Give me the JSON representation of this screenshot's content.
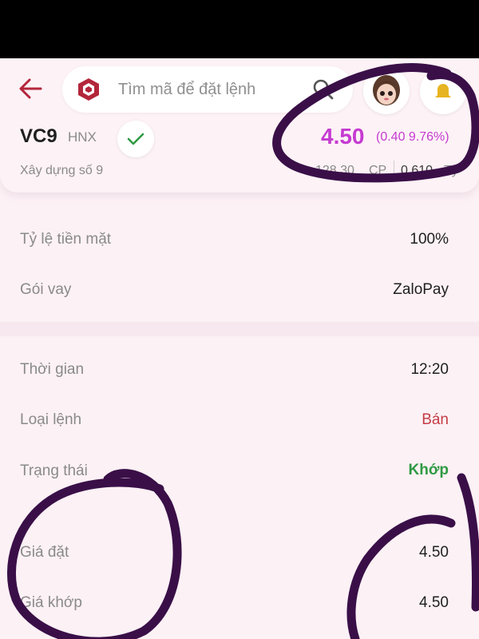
{
  "header": {
    "search": {
      "placeholder": "Tìm mã để đặt lệnh"
    },
    "stock": {
      "ticker": "VC9",
      "exchange": "HNX",
      "company": "Xây dựng số 9",
      "price": "4.50",
      "change": "(0.40 9.76%)",
      "volume": "128.30",
      "volume_unit": "CP",
      "value": "0.610",
      "value_unit": "Tỷ"
    }
  },
  "details": {
    "loan_section": [
      {
        "label": "Tỷ lệ tiền mặt",
        "value": "100%"
      },
      {
        "label": "Gói vay",
        "value": "ZaloPay"
      }
    ],
    "order_section": [
      {
        "label": "Thời gian",
        "value": "12:20"
      },
      {
        "label": "Loại lệnh",
        "value": "Bán"
      },
      {
        "label": "Trạng thái",
        "value": "Khớp"
      },
      {
        "label": "Giá đặt",
        "value": "4.50"
      },
      {
        "label": "Giá khớp",
        "value": "4.50"
      }
    ]
  },
  "colors": {
    "background": "#fcf1f5",
    "price": "#c53bd1",
    "sell": "#c43d45",
    "matched": "#2f9a43",
    "back_arrow": "#b3263b",
    "annotation": "#3a0f48"
  },
  "icons": {
    "back": "arrow-left-icon",
    "logo": "brand-logo-icon",
    "search": "search-icon",
    "avatar": "user-avatar",
    "bell": "bell-icon",
    "check": "check-icon"
  }
}
